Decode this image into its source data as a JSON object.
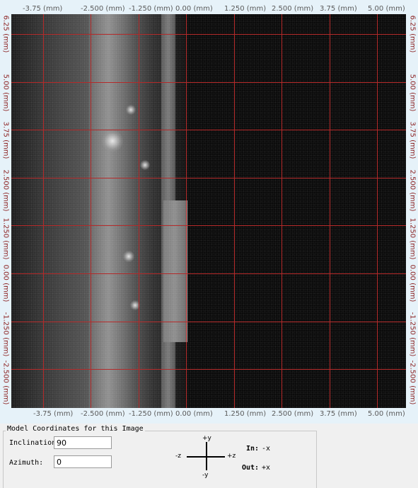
{
  "viewer": {
    "x_labels": [
      "-3.75 (mm)",
      "-2.500 (mm)",
      "-1.250 (mm)",
      "0.00 (mm)",
      "1.250 (mm)",
      "2.500 (mm)",
      "3.75 (mm)",
      "5.00 (mm)"
    ],
    "y_labels": [
      "6.25 (mm)",
      "5.00 (mm)",
      "3.75 (mm)",
      "2.500 (mm)",
      "1.250 (mm)",
      "0.00 (mm)",
      "-1.250 (mm)",
      "-2.500 (mm)"
    ]
  },
  "coords": {
    "title": "Model Coordinates for this Image",
    "inclination_label": "Inclination",
    "inclination_value": "90",
    "azimuth_label": "Azimuth:",
    "azimuth_value": "0",
    "axis_plus_y": "+y",
    "axis_minus_y": "-y",
    "axis_minus_z": "-z",
    "axis_plus_z": "+z",
    "in_label": "In:",
    "in_value": "-x",
    "out_label": "Out:",
    "out_value": "+x"
  },
  "colors": {
    "grid": "#b52a2a",
    "label_text": "#8a1d1d"
  }
}
